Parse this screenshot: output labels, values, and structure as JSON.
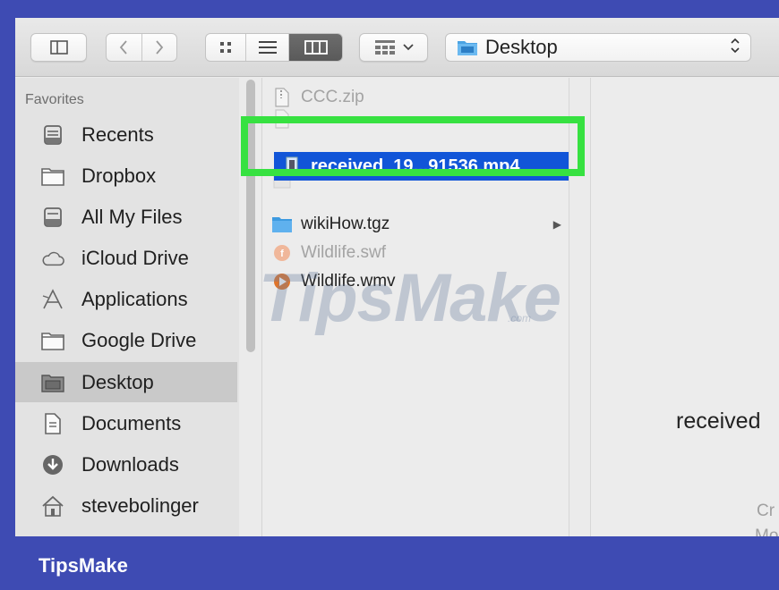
{
  "toolbar": {
    "sidebar_toggle_icon": "sidebar-toggle-icon",
    "back_icon": "chevron-left-icon",
    "forward_icon": "chevron-right-icon",
    "view_modes": [
      "icon",
      "list",
      "column"
    ],
    "active_view": "column",
    "arrange_icon": "arrange-grid-icon",
    "path_label": "Desktop"
  },
  "sidebar": {
    "header": "Favorites",
    "items": [
      {
        "label": "Recents",
        "icon": "recents-icon"
      },
      {
        "label": "Dropbox",
        "icon": "folder-icon"
      },
      {
        "label": "All My Files",
        "icon": "all-files-icon"
      },
      {
        "label": "iCloud Drive",
        "icon": "cloud-icon"
      },
      {
        "label": "Applications",
        "icon": "applications-icon"
      },
      {
        "label": "Google Drive",
        "icon": "folder-icon"
      },
      {
        "label": "Desktop",
        "icon": "desktop-folder-icon",
        "selected": true
      },
      {
        "label": "Documents",
        "icon": "documents-icon"
      },
      {
        "label": "Downloads",
        "icon": "downloads-icon"
      },
      {
        "label": "stevebolinger",
        "icon": "home-icon"
      }
    ]
  },
  "files": [
    {
      "name": "CCC.zip",
      "dim": true
    },
    {
      "name": "received_19...91536.mp4",
      "selected": true
    },
    {
      "name": "wikiHow.tgz",
      "folder": true
    },
    {
      "name": "Wildlife.swf",
      "dim": true
    },
    {
      "name": "Wildlife.wmv"
    }
  ],
  "preview": {
    "name": "received",
    "meta1": "Cr",
    "meta2": "Mo"
  },
  "watermark": {
    "text": "TipsMake",
    "suffix": ".com"
  },
  "brand": "TipsMake",
  "colors": {
    "selection": "#1155d8",
    "highlight": "#37e141",
    "frame": "#3e4bb3"
  }
}
